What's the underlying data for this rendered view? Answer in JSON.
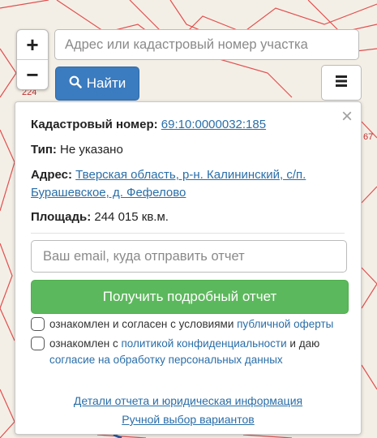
{
  "search": {
    "placeholder": "Адрес или кадастровый номер участка"
  },
  "find_button": {
    "label": "Найти",
    "icon": "search-icon"
  },
  "zoom": {
    "plus": "+",
    "minus": "−"
  },
  "map": {
    "label_left": "224",
    "label_right": "67"
  },
  "menu": {
    "icon": "hamburger-icon"
  },
  "panel": {
    "close": "×",
    "cadastral_label": "Кадастровый номер:",
    "cadastral_value": "69:10:0000032:185",
    "type_label": "Тип:",
    "type_value": "Не указано",
    "address_label": "Адрес:",
    "address_line1": "Тверская область, р-н. Калининский, с/п.",
    "address_line2": "Бурашевское, д. Фефелово",
    "area_label": "Площадь:",
    "area_value": "244 015 кв.м.",
    "email_placeholder": "Ваш email, куда отправить отчет",
    "report_button": "Получить подробный отчет",
    "consent1_text": "ознакомлен и согласен с условиями",
    "consent1_link": "публичной оферты",
    "consent2_text": "ознакомлен с",
    "consent2_link": "политикой конфиденциальности",
    "consent2_mid": "и даю",
    "consent2_link2": "согласие на обработку персональных данных",
    "details_link": "Детали отчета и юридическая информация",
    "manual_link": "Ручной выбор вариантов"
  },
  "colors": {
    "accent_blue": "#3b7bbf",
    "green": "#5cb85c",
    "link": "#2a6ea8",
    "parcel_line": "#e05050"
  }
}
